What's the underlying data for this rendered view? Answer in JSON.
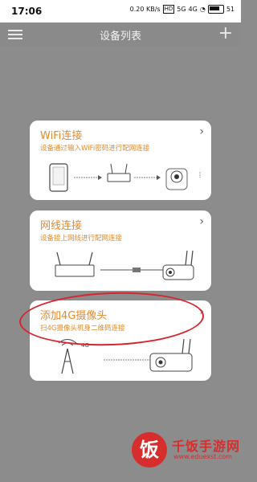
{
  "status_bar": {
    "time": "17:06",
    "speed": "0.20 KB/s",
    "hd": "HD",
    "signal1": "5G",
    "signal2": "4G",
    "battery": "51"
  },
  "header": {
    "title": "设备列表",
    "menu_icon": "menu-icon",
    "add_icon": "plus-icon"
  },
  "cards": [
    {
      "title": "WiFi连接",
      "subtitle": "设备通过输入WiFi密码进行配网连接"
    },
    {
      "title": "网线连接",
      "subtitle": "设备接上网线进行配网连接"
    },
    {
      "title": "添加4G摄像头",
      "subtitle": "扫4G摄像头机身二维码连接",
      "badge": "4G"
    }
  ],
  "watermark": {
    "logo_char": "饭",
    "name": "千饭手游网",
    "url": "www.eduexst.com"
  },
  "colors": {
    "accent": "#e38a2e",
    "overlay": "#8c8c8c",
    "annotation": "#d9232d"
  }
}
